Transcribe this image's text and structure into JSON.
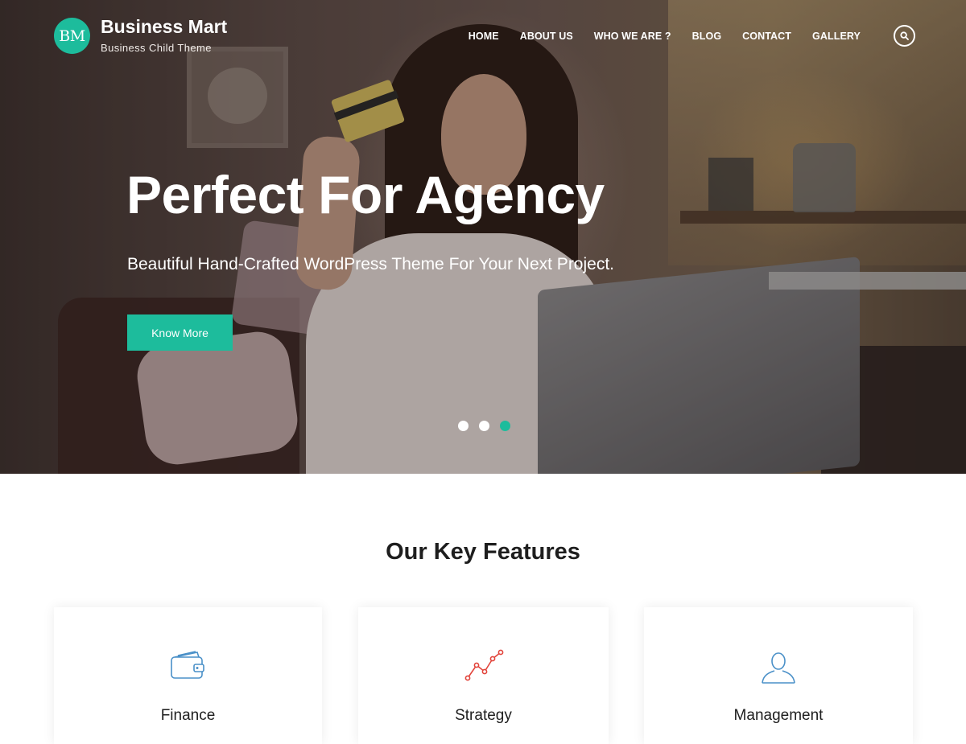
{
  "brand": {
    "logo_text": "BM",
    "title": "Business Mart",
    "tagline": "Business Child Theme",
    "accent_color": "#1dbc9c"
  },
  "nav": {
    "items": [
      {
        "label": "HOME"
      },
      {
        "label": "ABOUT US"
      },
      {
        "label": "WHO WE ARE ?"
      },
      {
        "label": "BLOG"
      },
      {
        "label": "CONTACT"
      },
      {
        "label": "GALLERY"
      }
    ],
    "search_icon": "search-icon"
  },
  "hero": {
    "title": "Perfect For Agency",
    "subtitle": "Beautiful Hand-Crafted WordPress Theme For Your Next Project.",
    "button_label": "Know More",
    "slides_total": 3,
    "active_slide": 3
  },
  "features": {
    "heading": "Our Key Features",
    "items": [
      {
        "name": "Finance",
        "icon": "wallet-icon",
        "icon_color": "#4a90c8"
      },
      {
        "name": "Strategy",
        "icon": "trend-chart-icon",
        "icon_color": "#e2453c"
      },
      {
        "name": "Management",
        "icon": "user-icon",
        "icon_color": "#4a90c8"
      }
    ]
  }
}
